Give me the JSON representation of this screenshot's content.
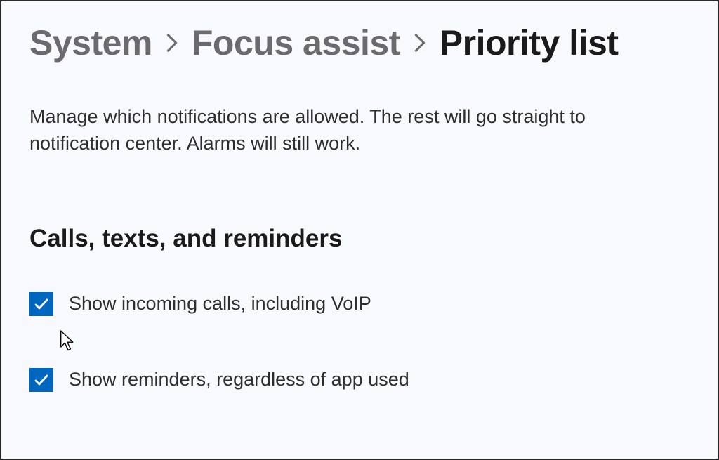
{
  "breadcrumb": {
    "items": [
      {
        "label": "System"
      },
      {
        "label": "Focus assist"
      }
    ],
    "current": "Priority list"
  },
  "description": "Manage which notifications are allowed. The rest will go straight to notification center. Alarms will still work.",
  "section": {
    "heading": "Calls, texts, and reminders",
    "options": [
      {
        "label": "Show incoming calls, including VoIP",
        "checked": true
      },
      {
        "label": "Show reminders, regardless of app used",
        "checked": true
      }
    ]
  },
  "colors": {
    "accent": "#0067c0"
  }
}
